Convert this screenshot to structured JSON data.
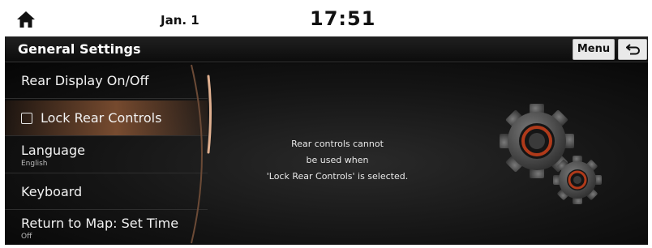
{
  "status_bar": {
    "home_icon": "home-icon",
    "date": "Jan. 1",
    "time": "17:51"
  },
  "header": {
    "title": "General Settings",
    "menu_label": "Menu",
    "back_icon": "back-arrow-icon"
  },
  "settings_list": {
    "items": [
      {
        "label": "Rear Display On/Off",
        "sub": ""
      },
      {
        "label": "Lock Rear Controls",
        "sub": "",
        "checked": false,
        "selected": true
      },
      {
        "label": "Language",
        "sub": "English"
      },
      {
        "label": "Keyboard",
        "sub": ""
      },
      {
        "label": "Return to Map: Set Time",
        "sub": "Off"
      }
    ]
  },
  "message": {
    "line1": "Rear controls cannot",
    "line2": "be used when",
    "line3": "'Lock Rear Controls' is selected."
  },
  "illustration": {
    "icon": "gears-icon"
  },
  "colors": {
    "background": "#000000",
    "selection": "#c87846",
    "gear_accent": "#b03a1a"
  }
}
